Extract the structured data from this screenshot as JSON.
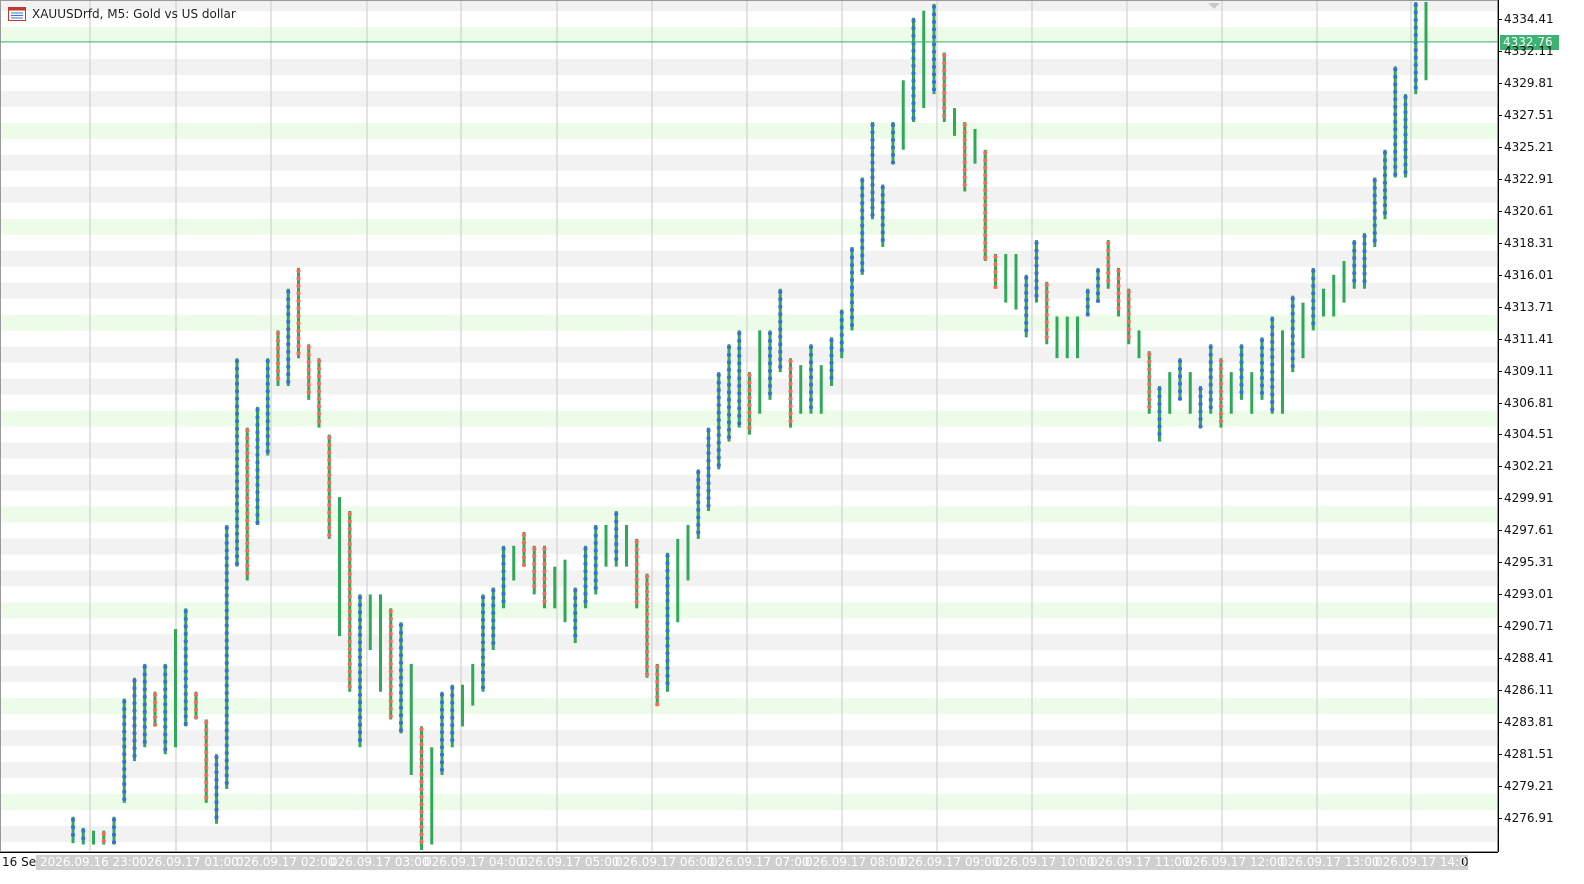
{
  "window": {
    "title": "XAUUSDrfd, M5:  Gold vs US dollar",
    "icon": "chart-window-icon"
  },
  "price_axis": {
    "ticks": [
      "4334.41",
      "4332.11",
      "4329.81",
      "4327.51",
      "4325.21",
      "4322.91",
      "4320.61",
      "4318.31",
      "4316.01",
      "4313.71",
      "4311.41",
      "4309.11",
      "4306.81",
      "4304.51",
      "4302.21",
      "4299.91",
      "4297.61",
      "4295.31",
      "4293.01",
      "4290.71",
      "4288.41",
      "4286.11",
      "4283.81",
      "4281.51",
      "4279.21",
      "4276.91"
    ],
    "current_price": "4332.76",
    "current_price_color": "#3cb371"
  },
  "time_axis": {
    "first_label": "16 Se",
    "labels": [
      "2026.09.16 23:00",
      "26.09.17 01:00",
      "026.09.17 02:00",
      "026.09.17 03:00",
      "026.09.17 04:00",
      "026.09.17 05:00",
      "026.09.17 06:00",
      "026.09.17 07:00",
      "026.09.17 08:00",
      "026.09.17 09:00",
      "026.09.17 10:00",
      "026.09.17 11:00",
      "026.09.17 12:00",
      "026.09.17 13:00",
      "026.09.17 14:00"
    ],
    "last_tail": "0"
  },
  "colors": {
    "bar": "#2eaa56",
    "dot_up": "#3a6fd8",
    "dot_down": "#ef6f5a",
    "band_grey": "#f2f2f2",
    "band_green": "#edfbe9",
    "grid": "#c9c9c9",
    "current_line": "#3cb371"
  },
  "chart_data": {
    "type": "bar",
    "series_kind": "OHLC price bars (high-low) with per-bar markers",
    "symbol": "XAUUSDrfd",
    "timeframe": "M5",
    "ylim": [
      4275.0,
      4336.0
    ],
    "current_price": 4332.76,
    "bars": [
      {
        "low": 4275.1,
        "high": 4277.0,
        "m": "up"
      },
      {
        "low": 4275.0,
        "high": 4276.2,
        "m": "up"
      },
      {
        "low": 4275.0,
        "high": 4276.0,
        "m": "none"
      },
      {
        "low": 4275.0,
        "high": 4276.0,
        "m": "down"
      },
      {
        "low": 4275.0,
        "high": 4277.0,
        "m": "up"
      },
      {
        "low": 4278.0,
        "high": 4285.5,
        "m": "up"
      },
      {
        "low": 4281.0,
        "high": 4287.0,
        "m": "up"
      },
      {
        "low": 4282.0,
        "high": 4288.0,
        "m": "up"
      },
      {
        "low": 4283.5,
        "high": 4286.0,
        "m": "down"
      },
      {
        "low": 4281.5,
        "high": 4288.0,
        "m": "up"
      },
      {
        "low": 4282.0,
        "high": 4290.5,
        "m": "none"
      },
      {
        "low": 4283.5,
        "high": 4292.0,
        "m": "up"
      },
      {
        "low": 4284.0,
        "high": 4286.0,
        "m": "down"
      },
      {
        "low": 4278.0,
        "high": 4284.0,
        "m": "down"
      },
      {
        "low": 4276.5,
        "high": 4281.5,
        "m": "up"
      },
      {
        "low": 4279.0,
        "high": 4298.0,
        "m": "up"
      },
      {
        "low": 4295.0,
        "high": 4310.0,
        "m": "up"
      },
      {
        "low": 4294.0,
        "high": 4305.0,
        "m": "down"
      },
      {
        "low": 4298.0,
        "high": 4306.5,
        "m": "up"
      },
      {
        "low": 4303.0,
        "high": 4310.0,
        "m": "up"
      },
      {
        "low": 4308.0,
        "high": 4312.0,
        "m": "down"
      },
      {
        "low": 4308.0,
        "high": 4315.0,
        "m": "up"
      },
      {
        "low": 4310.0,
        "high": 4316.5,
        "m": "down"
      },
      {
        "low": 4307.0,
        "high": 4311.0,
        "m": "down"
      },
      {
        "low": 4305.0,
        "high": 4310.0,
        "m": "down"
      },
      {
        "low": 4297.0,
        "high": 4304.5,
        "m": "down"
      },
      {
        "low": 4290.0,
        "high": 4300.0,
        "m": "none"
      },
      {
        "low": 4286.0,
        "high": 4299.0,
        "m": "down"
      },
      {
        "low": 4282.0,
        "high": 4293.0,
        "m": "up"
      },
      {
        "low": 4289.0,
        "high": 4293.0,
        "m": "none"
      },
      {
        "low": 4286.0,
        "high": 4293.0,
        "m": "none"
      },
      {
        "low": 4284.0,
        "high": 4292.0,
        "m": "down"
      },
      {
        "low": 4283.0,
        "high": 4291.0,
        "m": "up"
      },
      {
        "low": 4280.0,
        "high": 4288.0,
        "m": "none"
      },
      {
        "low": 4274.0,
        "high": 4283.5,
        "m": "down"
      },
      {
        "low": 4275.0,
        "high": 4282.0,
        "m": "none"
      },
      {
        "low": 4280.0,
        "high": 4286.0,
        "m": "up"
      },
      {
        "low": 4282.0,
        "high": 4286.5,
        "m": "up"
      },
      {
        "low": 4283.5,
        "high": 4286.5,
        "m": "none"
      },
      {
        "low": 4285.0,
        "high": 4288.0,
        "m": "none"
      },
      {
        "low": 4286.0,
        "high": 4293.0,
        "m": "up"
      },
      {
        "low": 4289.0,
        "high": 4293.5,
        "m": "up"
      },
      {
        "low": 4292.0,
        "high": 4296.5,
        "m": "up"
      },
      {
        "low": 4294.0,
        "high": 4296.5,
        "m": "none"
      },
      {
        "low": 4295.0,
        "high": 4297.5,
        "m": "down"
      },
      {
        "low": 4293.0,
        "high": 4296.5,
        "m": "down"
      },
      {
        "low": 4292.0,
        "high": 4296.5,
        "m": "down"
      },
      {
        "low": 4292.0,
        "high": 4295.0,
        "m": "none"
      },
      {
        "low": 4291.0,
        "high": 4295.5,
        "m": "none"
      },
      {
        "low": 4289.5,
        "high": 4293.5,
        "m": "up"
      },
      {
        "low": 4292.0,
        "high": 4296.5,
        "m": "up"
      },
      {
        "low": 4293.0,
        "high": 4298.0,
        "m": "up"
      },
      {
        "low": 4295.0,
        "high": 4298.0,
        "m": "none"
      },
      {
        "low": 4295.0,
        "high": 4299.0,
        "m": "up"
      },
      {
        "low": 4295.0,
        "high": 4298.0,
        "m": "none"
      },
      {
        "low": 4292.0,
        "high": 4297.0,
        "m": "down"
      },
      {
        "low": 4287.0,
        "high": 4294.5,
        "m": "down"
      },
      {
        "low": 4285.0,
        "high": 4288.0,
        "m": "down"
      },
      {
        "low": 4286.0,
        "high": 4296.0,
        "m": "up"
      },
      {
        "low": 4291.0,
        "high": 4297.0,
        "m": "none"
      },
      {
        "low": 4294.0,
        "high": 4298.0,
        "m": "none"
      },
      {
        "low": 4297.0,
        "high": 4302.0,
        "m": "up"
      },
      {
        "low": 4299.0,
        "high": 4305.0,
        "m": "up"
      },
      {
        "low": 4302.0,
        "high": 4309.0,
        "m": "up"
      },
      {
        "low": 4304.0,
        "high": 4311.0,
        "m": "up"
      },
      {
        "low": 4305.0,
        "high": 4312.0,
        "m": "up"
      },
      {
        "low": 4304.5,
        "high": 4309.0,
        "m": "down"
      },
      {
        "low": 4306.0,
        "high": 4312.0,
        "m": "none"
      },
      {
        "low": 4307.0,
        "high": 4312.0,
        "m": "up"
      },
      {
        "low": 4309.0,
        "high": 4315.0,
        "m": "up"
      },
      {
        "low": 4305.0,
        "high": 4310.0,
        "m": "down"
      },
      {
        "low": 4306.0,
        "high": 4309.5,
        "m": "none"
      },
      {
        "low": 4306.0,
        "high": 4311.0,
        "m": "up"
      },
      {
        "low": 4306.0,
        "high": 4309.5,
        "m": "none"
      },
      {
        "low": 4308.0,
        "high": 4311.5,
        "m": "up"
      },
      {
        "low": 4310.0,
        "high": 4313.5,
        "m": "up"
      },
      {
        "low": 4312.0,
        "high": 4318.0,
        "m": "up"
      },
      {
        "low": 4316.0,
        "high": 4323.0,
        "m": "up"
      },
      {
        "low": 4320.0,
        "high": 4327.0,
        "m": "up"
      },
      {
        "low": 4318.0,
        "high": 4322.5,
        "m": "up"
      },
      {
        "low": 4324.0,
        "high": 4327.0,
        "m": "up"
      },
      {
        "low": 4325.0,
        "high": 4330.0,
        "m": "none"
      },
      {
        "low": 4327.0,
        "high": 4334.5,
        "m": "up"
      },
      {
        "low": 4328.0,
        "high": 4335.0,
        "m": "none"
      },
      {
        "low": 4329.0,
        "high": 4335.5,
        "m": "up"
      },
      {
        "low": 4327.0,
        "high": 4332.0,
        "m": "down"
      },
      {
        "low": 4326.0,
        "high": 4328.0,
        "m": "none"
      },
      {
        "low": 4322.0,
        "high": 4327.0,
        "m": "down"
      },
      {
        "low": 4324.0,
        "high": 4326.5,
        "m": "none"
      },
      {
        "low": 4317.0,
        "high": 4325.0,
        "m": "down"
      },
      {
        "low": 4315.0,
        "high": 4317.5,
        "m": "down"
      },
      {
        "low": 4314.0,
        "high": 4317.5,
        "m": "none"
      },
      {
        "low": 4313.5,
        "high": 4317.5,
        "m": "none"
      },
      {
        "low": 4311.5,
        "high": 4316.0,
        "m": "up"
      },
      {
        "low": 4314.0,
        "high": 4318.5,
        "m": "up"
      },
      {
        "low": 4311.0,
        "high": 4315.5,
        "m": "down"
      },
      {
        "low": 4310.0,
        "high": 4313.0,
        "m": "none"
      },
      {
        "low": 4310.0,
        "high": 4313.0,
        "m": "none"
      },
      {
        "low": 4310.0,
        "high": 4313.0,
        "m": "none"
      },
      {
        "low": 4313.0,
        "high": 4315.0,
        "m": "up"
      },
      {
        "low": 4314.0,
        "high": 4316.5,
        "m": "up"
      },
      {
        "low": 4315.0,
        "high": 4318.5,
        "m": "down"
      },
      {
        "low": 4313.0,
        "high": 4316.5,
        "m": "down"
      },
      {
        "low": 4311.0,
        "high": 4315.0,
        "m": "down"
      },
      {
        "low": 4310.0,
        "high": 4312.0,
        "m": "none"
      },
      {
        "low": 4306.0,
        "high": 4310.5,
        "m": "down"
      },
      {
        "low": 4304.0,
        "high": 4308.0,
        "m": "up"
      },
      {
        "low": 4306.0,
        "high": 4309.0,
        "m": "none"
      },
      {
        "low": 4307.0,
        "high": 4310.0,
        "m": "up"
      },
      {
        "low": 4306.0,
        "high": 4309.0,
        "m": "none"
      },
      {
        "low": 4305.0,
        "high": 4308.0,
        "m": "up"
      },
      {
        "low": 4306.0,
        "high": 4311.0,
        "m": "up"
      },
      {
        "low": 4305.0,
        "high": 4310.0,
        "m": "down"
      },
      {
        "low": 4306.0,
        "high": 4309.0,
        "m": "none"
      },
      {
        "low": 4307.0,
        "high": 4311.0,
        "m": "up"
      },
      {
        "low": 4306.0,
        "high": 4309.0,
        "m": "none"
      },
      {
        "low": 4307.0,
        "high": 4311.5,
        "m": "up"
      },
      {
        "low": 4306.0,
        "high": 4313.0,
        "m": "up"
      },
      {
        "low": 4306.0,
        "high": 4312.0,
        "m": "none"
      },
      {
        "low": 4309.0,
        "high": 4314.5,
        "m": "up"
      },
      {
        "low": 4310.0,
        "high": 4314.0,
        "m": "none"
      },
      {
        "low": 4312.0,
        "high": 4316.5,
        "m": "up"
      },
      {
        "low": 4313.0,
        "high": 4315.0,
        "m": "none"
      },
      {
        "low": 4313.0,
        "high": 4316.0,
        "m": "none"
      },
      {
        "low": 4314.0,
        "high": 4317.0,
        "m": "none"
      },
      {
        "low": 4315.0,
        "high": 4318.5,
        "m": "up"
      },
      {
        "low": 4315.0,
        "high": 4319.0,
        "m": "up"
      },
      {
        "low": 4318.0,
        "high": 4323.0,
        "m": "up"
      },
      {
        "low": 4320.0,
        "high": 4325.0,
        "m": "up"
      },
      {
        "low": 4323.0,
        "high": 4331.0,
        "m": "up"
      },
      {
        "low": 4323.0,
        "high": 4329.0,
        "m": "up"
      },
      {
        "low": 4329.0,
        "high": 4336.0,
        "m": "up"
      },
      {
        "low": 4330.0,
        "high": 4336.0,
        "m": "none"
      }
    ]
  }
}
